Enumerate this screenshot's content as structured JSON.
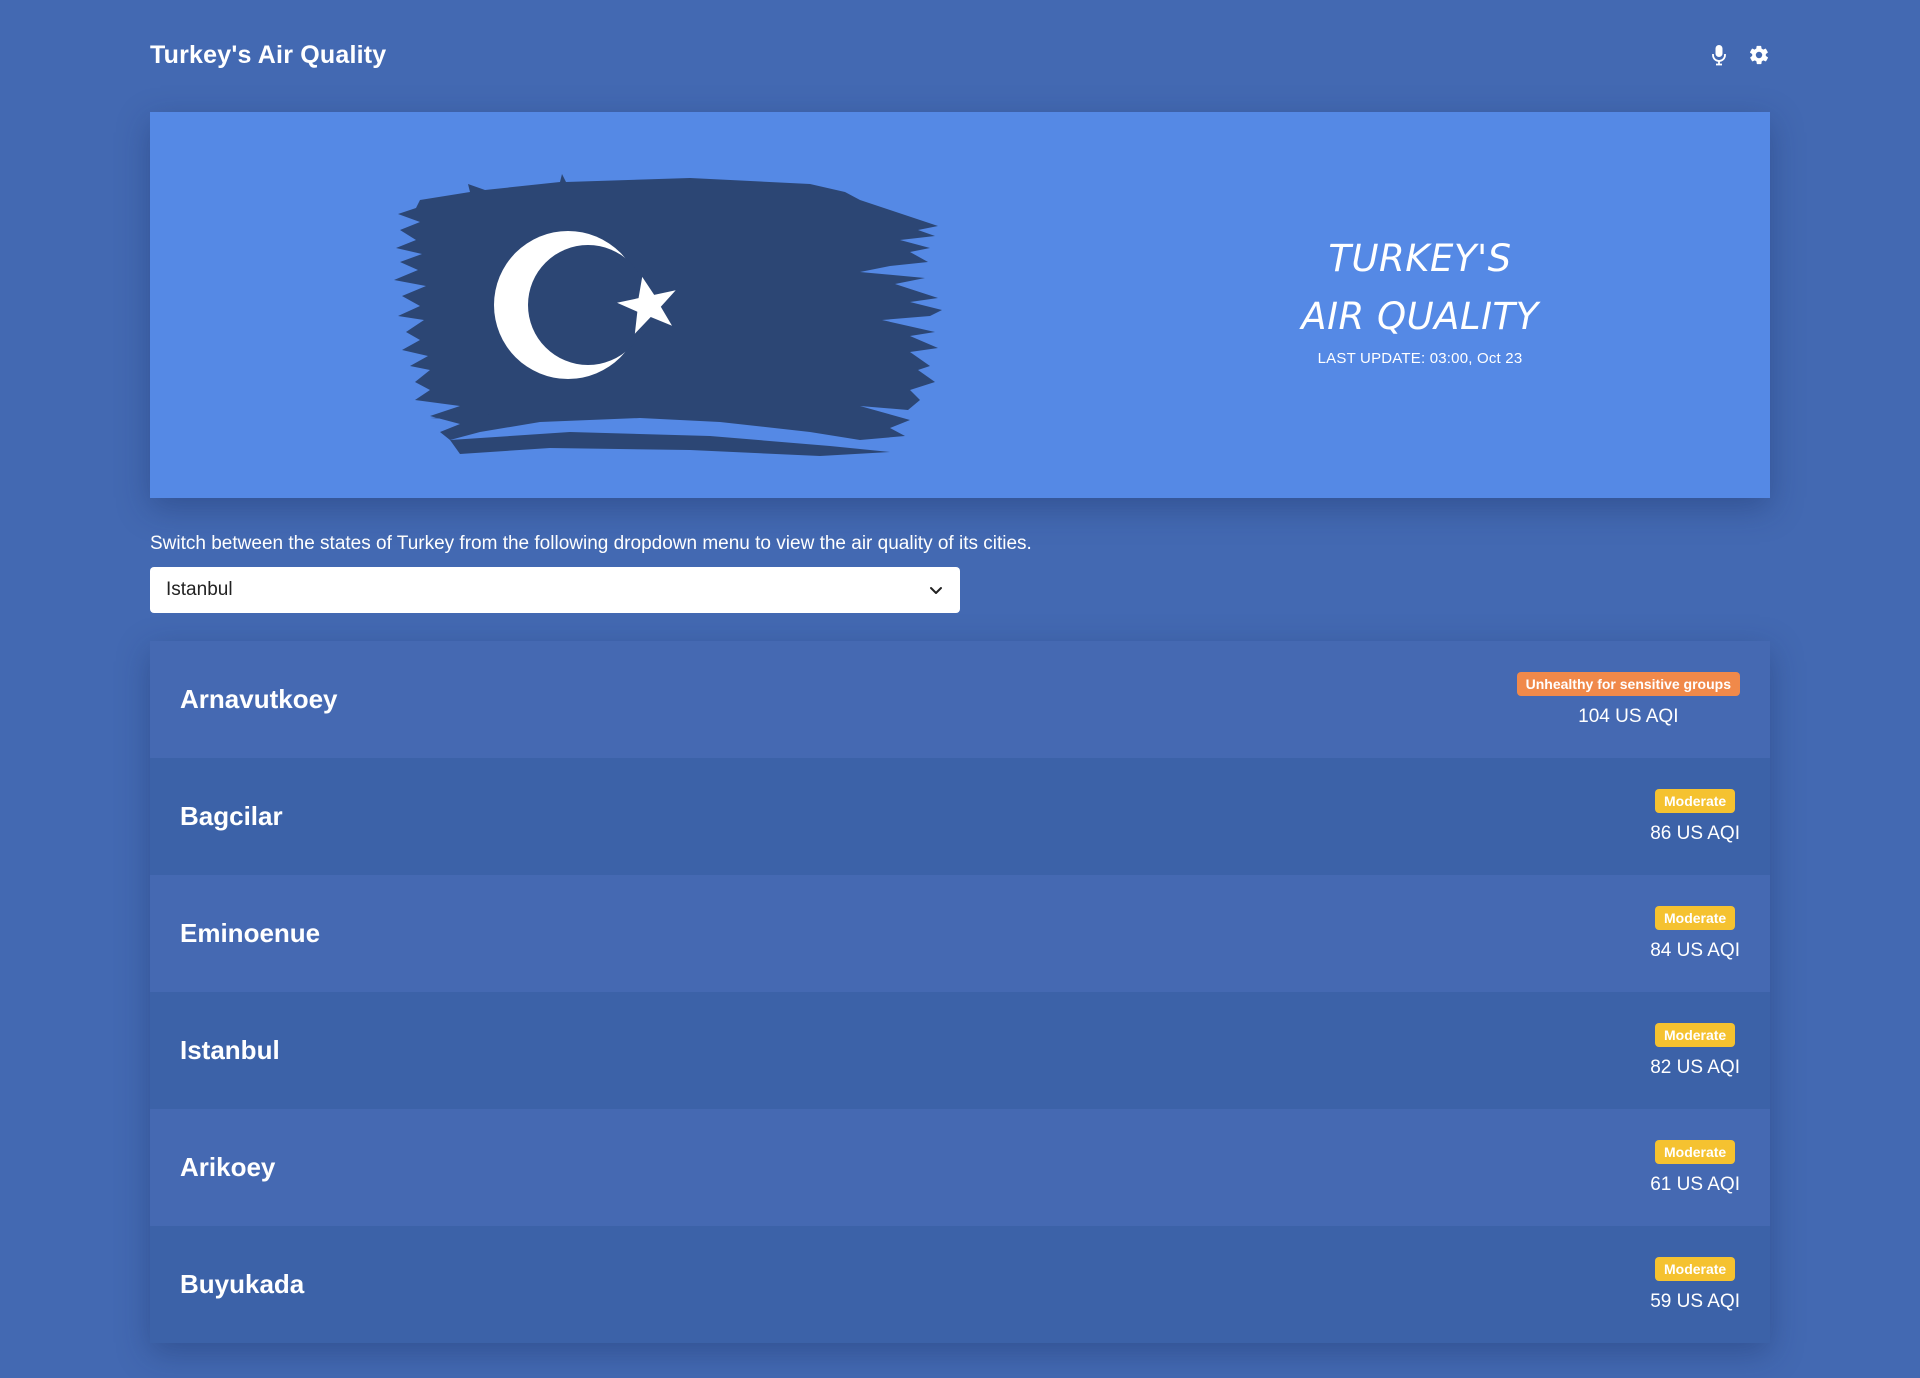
{
  "header": {
    "title": "Turkey's Air Quality",
    "icons": [
      "microphone-icon",
      "gear-icon"
    ]
  },
  "hero": {
    "title_line1": "TURKEY'S",
    "title_line2": "AIR QUALITY",
    "last_update": "LAST UPDATE: 03:00, Oct 23",
    "flag_color": "#2c4674",
    "background": "#5589e5"
  },
  "selector": {
    "instructions": "Switch between the states of Turkey from the following dropdown menu to view the air quality of its cities.",
    "selected": "Istanbul"
  },
  "colors": {
    "page_background": "#4369b2",
    "unhealthy_sensitive": "#f0894a",
    "moderate": "#f5c230"
  },
  "cities": [
    {
      "name": "Arnavutkoey",
      "status": "Unhealthy for sensitive groups",
      "status_color": "#f0894a",
      "aqi": "104 US AQI"
    },
    {
      "name": "Bagcilar",
      "status": "Moderate",
      "status_color": "#f5c230",
      "aqi": "86 US AQI"
    },
    {
      "name": "Eminoenue",
      "status": "Moderate",
      "status_color": "#f5c230",
      "aqi": "84 US AQI"
    },
    {
      "name": "Istanbul",
      "status": "Moderate",
      "status_color": "#f5c230",
      "aqi": "82 US AQI"
    },
    {
      "name": "Arikoey",
      "status": "Moderate",
      "status_color": "#f5c230",
      "aqi": "61 US AQI"
    },
    {
      "name": "Buyukada",
      "status": "Moderate",
      "status_color": "#f5c230",
      "aqi": "59 US AQI"
    }
  ]
}
